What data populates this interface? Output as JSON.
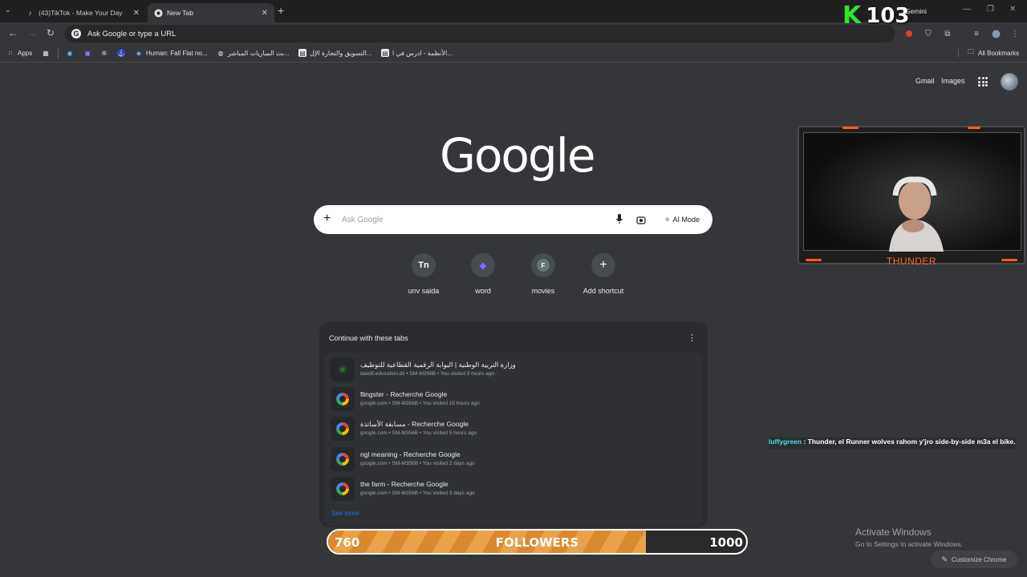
{
  "tabs": [
    {
      "title": "(43)TikTok - Make Your Day",
      "icon": "tiktok-icon"
    },
    {
      "title": "New Tab",
      "icon": "chrome-icon",
      "active": true
    }
  ],
  "toolbar": {
    "omnibox_text": "Ask Google or type a URL"
  },
  "bookmarks": {
    "apps_label": "Apps",
    "items": [
      {
        "label": "Human: Fall Flat no...",
        "icon": "human-fall-flat-icon"
      },
      {
        "label": "بث المباريات المباشر...",
        "icon": "sports-globe-icon"
      },
      {
        "label": "التسويق والتجارة الإل...",
        "icon": "page-icon"
      },
      {
        "label": "الأنظمة - ادرس في ا...",
        "icon": "page-icon"
      }
    ],
    "all_bookmarks": "All Bookmarks"
  },
  "ntp": {
    "gmail": "Gmail",
    "images": "Images",
    "logo": "Google",
    "search_placeholder": "Ask Google",
    "ai_mode": "AI Mode",
    "shortcuts": [
      {
        "label": "unv saida",
        "glyph": "Tn"
      },
      {
        "label": "word",
        "glyph": "◆"
      },
      {
        "label": "movies",
        "glyph": "F"
      },
      {
        "label": "Add shortcut",
        "glyph": "+"
      }
    ]
  },
  "continue_tabs": {
    "title": "Continue with these tabs",
    "items": [
      {
        "title": "وزارة التربية الوطنية | البوابة الرقمية القطاعية للتوظيف",
        "sub": "tawdif.education.dz • SM-M356B • You visited 9 hours ago",
        "icon": "education-icon"
      },
      {
        "title": "flingster - Recherche Google",
        "sub": "google.com • SM-M356B • You visited 15 hours ago",
        "icon": "google-icon"
      },
      {
        "title": "مسابقة الأساتذة - Recherche Google",
        "sub": "google.com • SM-M356B • You visited 5 hours ago",
        "icon": "google-icon"
      },
      {
        "title": "ngl meaning - Recherche Google",
        "sub": "google.com • SM-M356B • You visited 2 days ago",
        "icon": "google-icon"
      },
      {
        "title": "the farm - Recherche Google",
        "sub": "google.com • SM-M356B • You visited 3 days ago",
        "icon": "google-icon"
      }
    ],
    "see_more": "See more"
  },
  "stream": {
    "viewer_count": "103",
    "gemini_label": "Gemini",
    "streamer_name": "THUNDER",
    "chat": {
      "user": "luffygreen",
      "message": " : Thunder, el Runner wolves rahom y'jro side-by-side m3a el bike."
    },
    "followers": {
      "current": "760",
      "label": "FOLLOWERS",
      "target": "1000",
      "progress": 0.76
    }
  },
  "watermark": {
    "title": "Activate Windows",
    "subtitle": "Go to Settings to activate Windows."
  },
  "customize_label": "Customize Chrome",
  "colors": {
    "accent_orange": "#ff6a2a",
    "counter_green": "#2ee52e",
    "chat_user": "#3fe0e0",
    "link_blue": "#1a73e8"
  }
}
